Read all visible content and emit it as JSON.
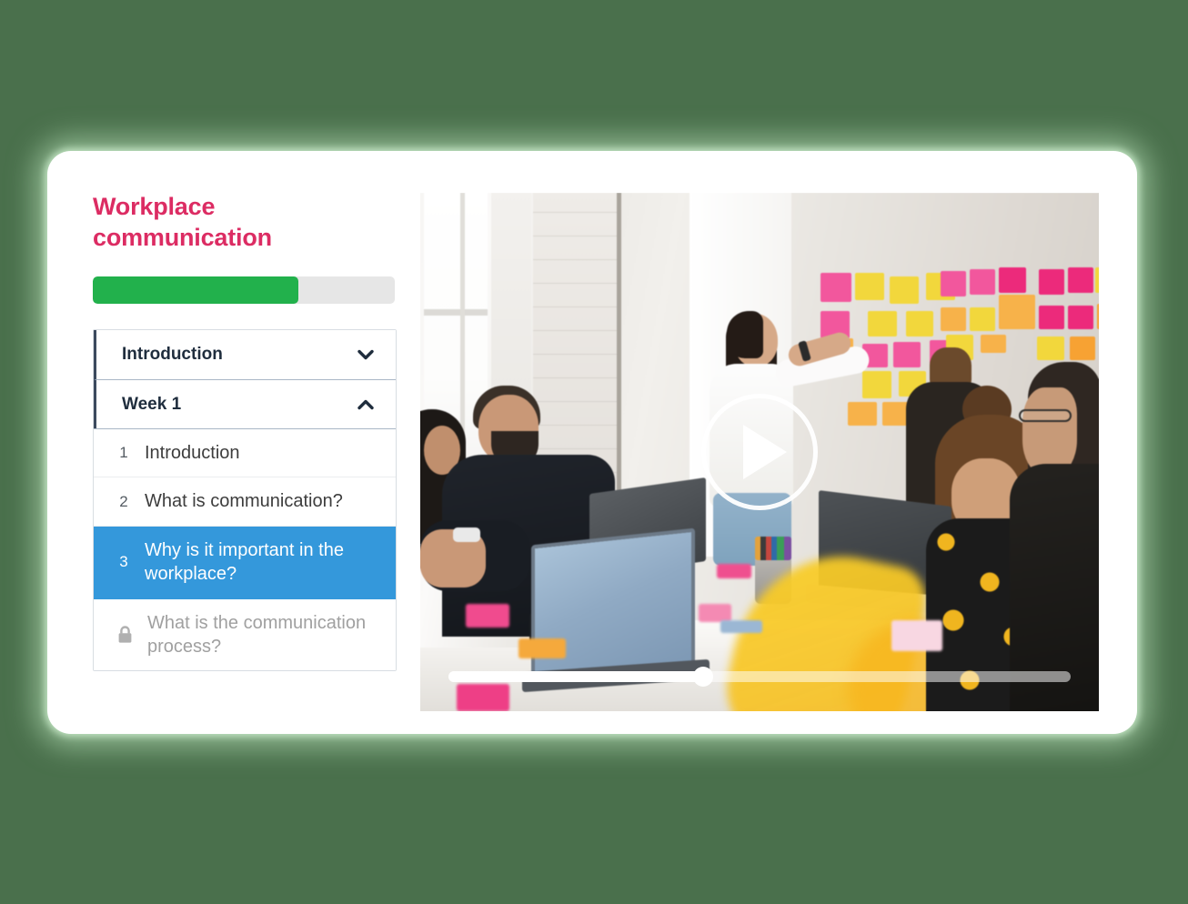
{
  "course": {
    "title": "Workplace communication",
    "progress_percent": 68
  },
  "accordion": {
    "sections": [
      {
        "label": "Introduction",
        "expanded": false,
        "chevron": "chevron-down-icon"
      },
      {
        "label": "Week 1",
        "expanded": true,
        "chevron": "chevron-up-icon"
      }
    ]
  },
  "lessons": [
    {
      "number": "1",
      "title": "Introduction",
      "state": "normal",
      "locked": false
    },
    {
      "number": "2",
      "title": "What is communication?",
      "state": "normal",
      "locked": false
    },
    {
      "number": "3",
      "title": "Why is it important in the workplace?",
      "state": "active",
      "locked": false
    },
    {
      "number": "",
      "title": "What is the communication process?",
      "state": "locked",
      "locked": true,
      "icon": "lock-icon"
    }
  ],
  "video": {
    "play_icon": "play-icon",
    "progress_percent": 41,
    "scene_description": "Team meeting in a bright office with people at a table and a woman placing sticky notes on a wall"
  },
  "colors": {
    "page_background": "#4a704c",
    "card_background": "#ffffff",
    "title_pink": "#dc2c63",
    "progress_green": "#22b14c",
    "progress_track": "#e6e6e6",
    "active_blue": "#3498db",
    "heading_navy": "#1f2d3d",
    "locked_gray": "#a0a0a0"
  }
}
